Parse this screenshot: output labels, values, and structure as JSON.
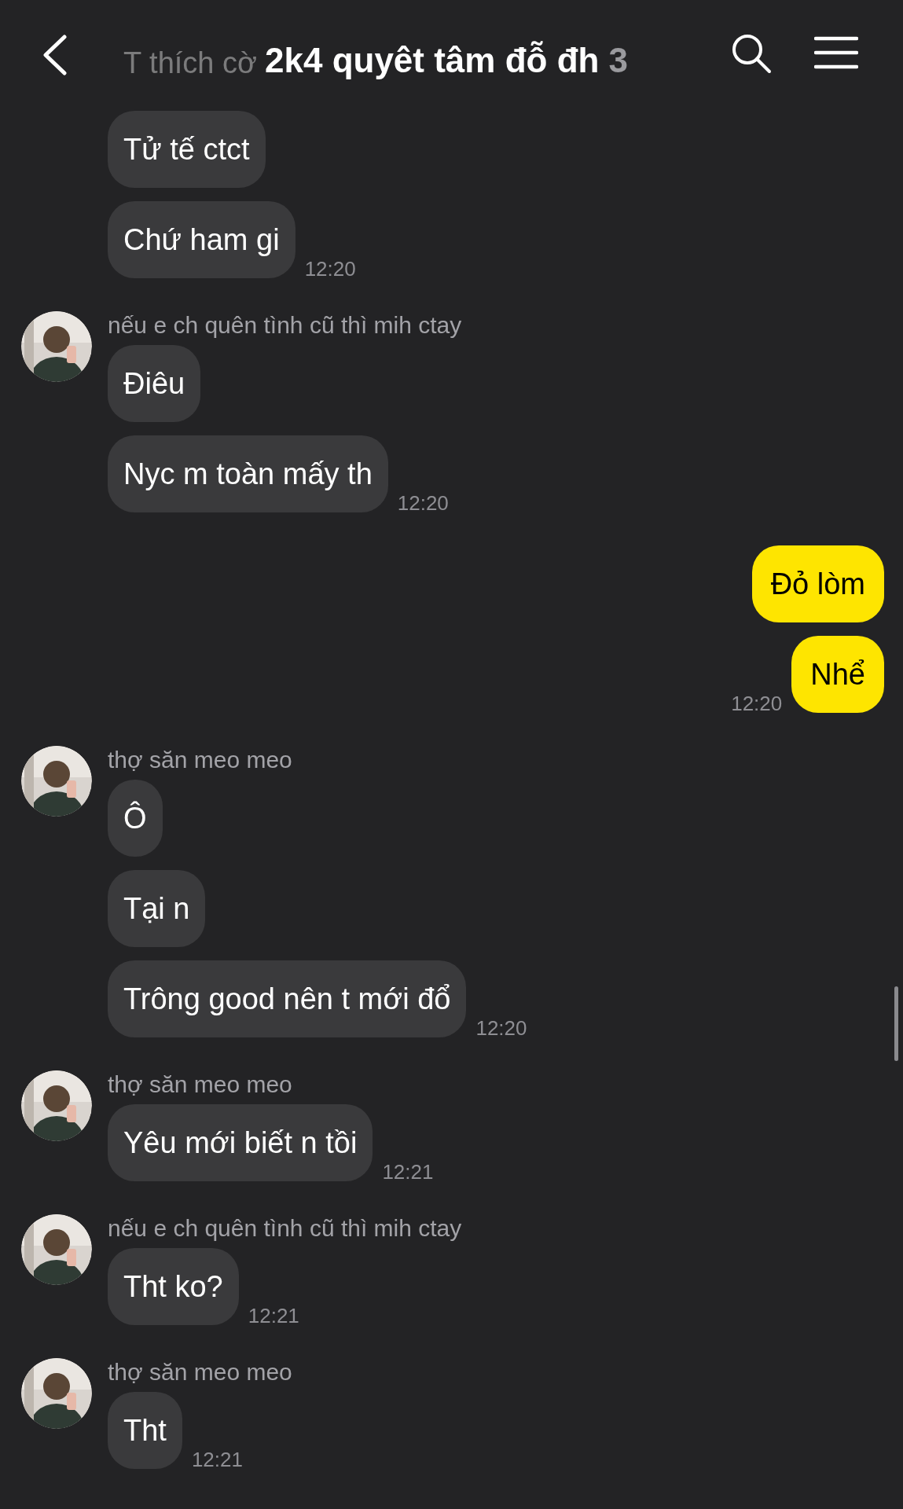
{
  "header": {
    "title": "2k4 quyêt tâm đỗ đh",
    "member_count": "3",
    "faded_message": "T thích cờ"
  },
  "groups": [
    {
      "kind": "incoming",
      "messages": [
        "Tử tế ctct",
        "Chứ ham gi"
      ],
      "time": "12:20"
    },
    {
      "kind": "incoming",
      "sender": "nếu e ch quên tình cũ thì mih ctay",
      "avatar": {
        "kind": "picture"
      },
      "messages": [
        "Điêu",
        "Nyc m toàn mấy th"
      ],
      "time": "12:20"
    },
    {
      "kind": "outgoing",
      "messages": [
        "Đỏ lòm",
        "Nhể"
      ],
      "time": "12:20"
    },
    {
      "kind": "incoming",
      "sender": "thợ săn meo meo",
      "avatar": {
        "kind": "picture"
      },
      "messages": [
        "Ô",
        "Tại n",
        "Trông good nên t mới đổ"
      ],
      "time": "12:20"
    },
    {
      "kind": "incoming",
      "sender": "thợ săn meo meo",
      "avatar": {
        "kind": "picture"
      },
      "messages": [
        "Yêu mới biết n tồi"
      ],
      "time": "12:21"
    },
    {
      "kind": "incoming",
      "sender": "nếu e ch quên tình cũ thì mih ctay",
      "avatar": {
        "kind": "picture"
      },
      "messages": [
        "Tht ko?"
      ],
      "time": "12:21"
    },
    {
      "kind": "incoming",
      "sender": "thợ săn meo meo",
      "avatar": {
        "kind": "picture"
      },
      "messages": [
        "Tht"
      ],
      "time": "12:21"
    }
  ]
}
